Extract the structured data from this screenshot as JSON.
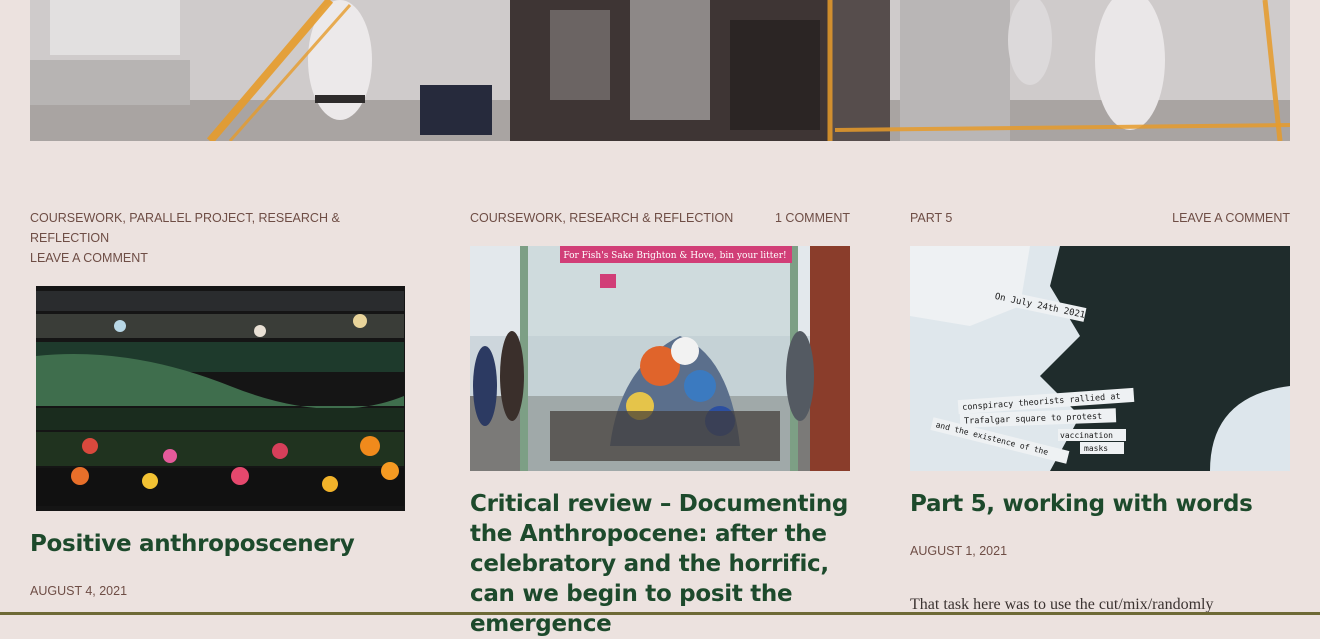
{
  "posts": [
    {
      "categories": "Coursework, Parallel Project, Research & Reflection",
      "comments": "Leave a comment",
      "title": "Positive anthroposcenery",
      "date": "August 4, 2021"
    },
    {
      "categories": "Coursework, Research & Reflection",
      "comments": "1 Comment",
      "title": "Critical review – Documenting the Anthropocene: after the celebratory and the horrific, can we begin to posit the emergence",
      "date": "",
      "sign_text": "For Fish's Sake Brighton & Hove, bin your litter!"
    },
    {
      "categories": "Part 5",
      "comments": "Leave a comment",
      "title": "Part 5, working with words",
      "date": "August 1, 2021",
      "excerpt": "That task here was to use the cut/mix/randomly",
      "collage_words": [
        "On July 24th 2021",
        "conspiracy theorists rallied at",
        "Trafalgar square to protest",
        "vaccination",
        "masks",
        "and the existence of the"
      ]
    }
  ],
  "colors": {
    "background": "#ece2df",
    "meta": "#6e4d45",
    "title": "#1d4a2c"
  }
}
